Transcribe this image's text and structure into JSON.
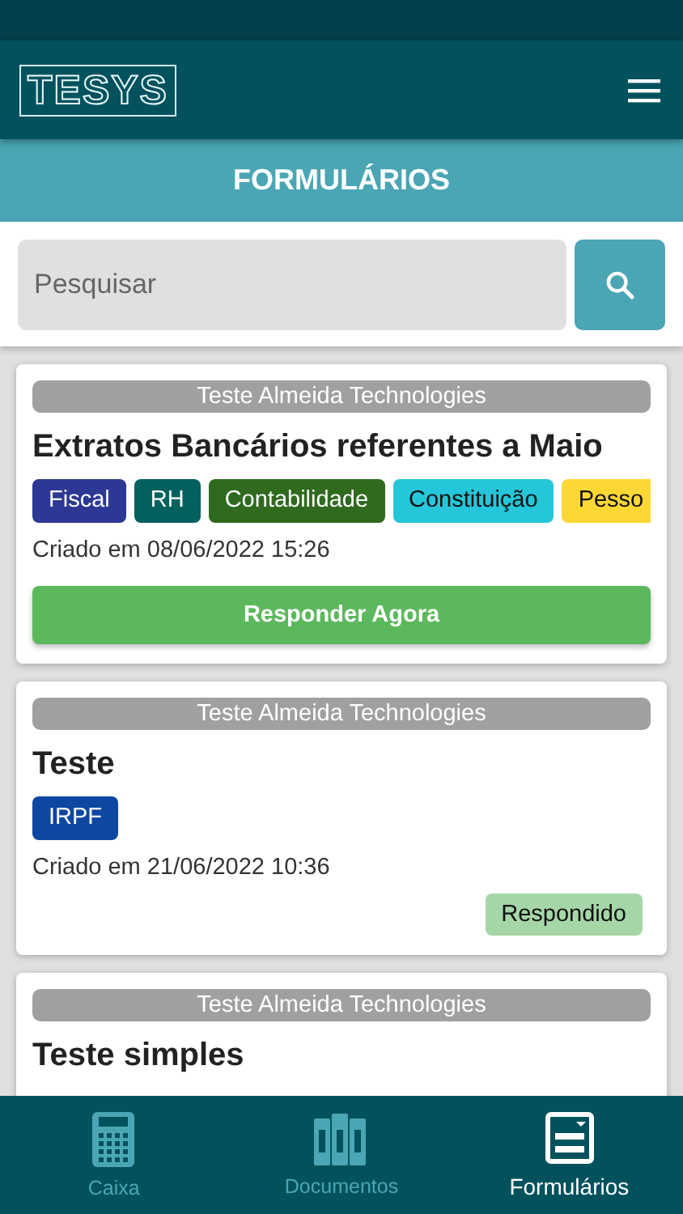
{
  "header": {
    "logo": "TESYS"
  },
  "page_title": "FORMULÁRIOS",
  "search": {
    "placeholder": "Pesquisar"
  },
  "forms": [
    {
      "kind": "pending",
      "company": "Teste Almeida Technologies",
      "title": "Extratos Bancários referentes a Maio",
      "tags": [
        {
          "label": "Fiscal",
          "color": "#2c3893"
        },
        {
          "label": "RH",
          "color": "#02605f"
        },
        {
          "label": "Contabilidade",
          "color": "#2f6a1f"
        },
        {
          "label": "Constituição",
          "color": "#26c6da"
        },
        {
          "label": "Pesso",
          "color": "#fdd835"
        }
      ],
      "created": "Criado em 08/06/2022 15:26",
      "action": "Responder Agora"
    },
    {
      "kind": "answered",
      "company": "Teste Almeida Technologies",
      "title": "Teste",
      "tags": [
        {
          "label": "IRPF",
          "color": "#0d47a1"
        }
      ],
      "created": "Criado em 21/06/2022 10:36",
      "action": "Respondido"
    },
    {
      "kind": "partial",
      "company": "Teste Almeida Technologies",
      "title": "Teste simples"
    }
  ],
  "nav": [
    {
      "label": "Caixa",
      "kind": "calculator",
      "selected": false
    },
    {
      "label": "Documentos",
      "kind": "binders",
      "selected": false
    },
    {
      "label": "Formulários",
      "kind": "form",
      "selected": true
    }
  ]
}
